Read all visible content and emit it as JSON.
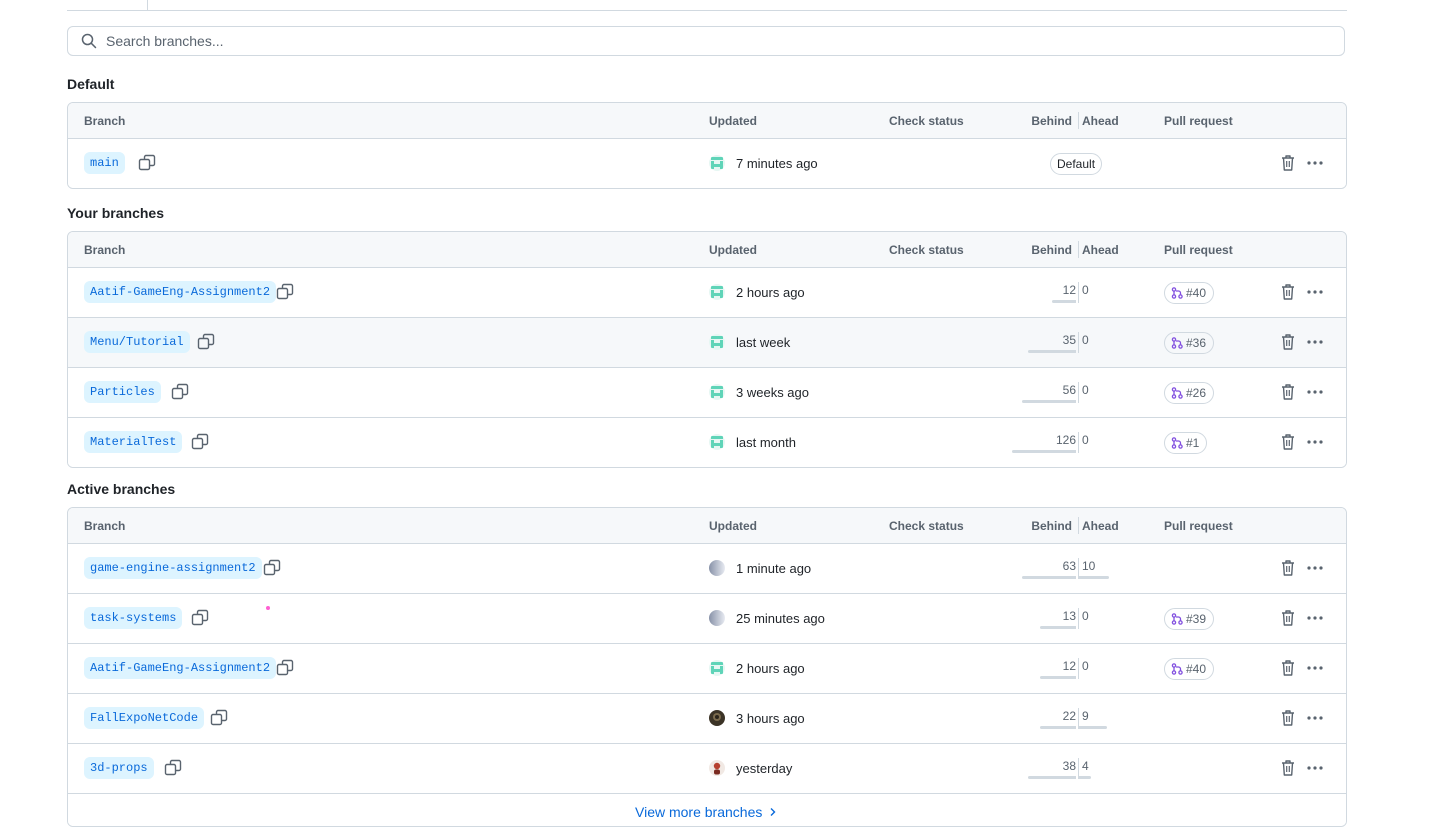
{
  "search": {
    "placeholder": "Search branches..."
  },
  "headers": {
    "branch": "Branch",
    "updated": "Updated",
    "check": "Check status",
    "behind": "Behind",
    "ahead": "Ahead",
    "pr": "Pull request"
  },
  "sections": {
    "default": {
      "title": "Default",
      "rows": [
        {
          "name": "main",
          "updated": "7 minutes ago",
          "badge": "Default",
          "avatar": "teal"
        }
      ]
    },
    "yours": {
      "title": "Your branches",
      "rows": [
        {
          "name": "Aatif-GameEng-Assignment2",
          "updated": "2 hours ago",
          "behind": "12",
          "ahead": "0",
          "behind_ratio": 0.24,
          "ahead_ratio": 0,
          "pr": "#40",
          "avatar": "teal"
        },
        {
          "name": "Menu/Tutorial",
          "updated": "last week",
          "behind": "35",
          "ahead": "0",
          "behind_ratio": 0.48,
          "ahead_ratio": 0,
          "pr": "#36",
          "avatar": "teal"
        },
        {
          "name": "Particles",
          "updated": "3 weeks ago",
          "behind": "56",
          "ahead": "0",
          "behind_ratio": 0.54,
          "ahead_ratio": 0,
          "pr": "#26",
          "avatar": "teal"
        },
        {
          "name": "MaterialTest",
          "updated": "last month",
          "behind": "126",
          "ahead": "0",
          "behind_ratio": 0.64,
          "ahead_ratio": 0,
          "pr": "#1",
          "avatar": "teal"
        }
      ]
    },
    "active": {
      "title": "Active branches",
      "rows": [
        {
          "name": "game-engine-assignment2",
          "updated": "1 minute ago",
          "behind": "63",
          "ahead": "10",
          "behind_ratio": 0.54,
          "ahead_ratio": 0.3,
          "pr": "",
          "avatar": "gray"
        },
        {
          "name": "task-systems",
          "updated": "25 minutes ago",
          "behind": "13",
          "ahead": "0",
          "behind_ratio": 0.36,
          "ahead_ratio": 0,
          "pr": "#39",
          "avatar": "gray"
        },
        {
          "name": "Aatif-GameEng-Assignment2",
          "updated": "2 hours ago",
          "behind": "12",
          "ahead": "0",
          "behind_ratio": 0.36,
          "ahead_ratio": 0,
          "pr": "#40",
          "avatar": "teal"
        },
        {
          "name": "FallExpoNetCode",
          "updated": "3 hours ago",
          "behind": "22",
          "ahead": "9",
          "behind_ratio": 0.36,
          "ahead_ratio": 0.28,
          "pr": "",
          "avatar": "dark"
        },
        {
          "name": "3d-props",
          "updated": "yesterday",
          "behind": "38",
          "ahead": "4",
          "behind_ratio": 0.48,
          "ahead_ratio": 0.12,
          "pr": "",
          "avatar": "red"
        }
      ]
    }
  },
  "view_more": "View more branches",
  "colors": {
    "link": "#0969da",
    "branch_bg": "#ddf4ff",
    "pr_icon": "#8250df",
    "border": "#d1d9e0",
    "header_bg": "#f6f8fa"
  }
}
